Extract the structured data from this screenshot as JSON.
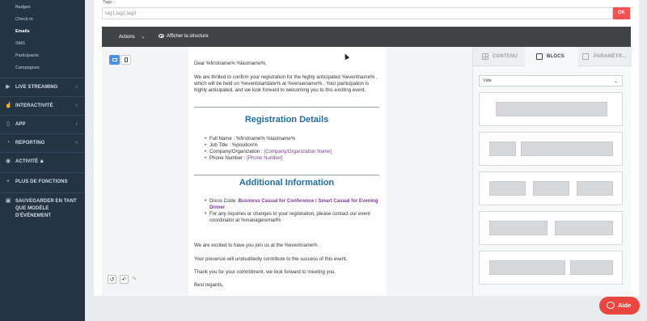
{
  "sidebar": {
    "sub_items": [
      {
        "label": "Badges"
      },
      {
        "label": "Check-in"
      },
      {
        "label": "Emails"
      },
      {
        "label": "SMS"
      },
      {
        "label": "Participants"
      },
      {
        "label": "Campagnes"
      }
    ],
    "sections": [
      {
        "label": "LIVE STREAMING",
        "icon": "play-icon"
      },
      {
        "label": "INTERACTIVITÉ",
        "icon": "interactivity-icon"
      },
      {
        "label": "APP",
        "icon": "phone-icon"
      },
      {
        "label": "REPORTING",
        "icon": "chart-icon"
      },
      {
        "label": "ACTIVITÉ",
        "icon": "eye-icon"
      },
      {
        "label": "PLUS DE FONCTIONS",
        "icon": "plus-icon"
      }
    ],
    "save_template": "SAUVEGARDER EN TANT QUE MODÈLE D'ÉVÉNEMENT"
  },
  "tags": {
    "label": "Tags :",
    "value": "tag1,tag2,tag3",
    "ok": "OK"
  },
  "toolbar": {
    "actions": "Actions",
    "show_structure": "Afficher la structure"
  },
  "email": {
    "greeting": "Dear %firstname% %lastname%,",
    "intro": "We are thrilled to confirm your registration for the highly anticipated %eventname% , which will be held on %eventstartdate% at %venuename% . Your participation is highly anticipated, and we look forward to welcoming you to this exciting event.",
    "reg_heading": "Registration Details",
    "reg_items": {
      "name": "Full Name : %firstname% %lastname%",
      "job": "Job Title : %position%",
      "company_label": "Company/Organization : ",
      "company_value": "[Company/Organization Name]",
      "phone_label": "Phone Number : ",
      "phone_value": "[Phone Number]"
    },
    "add_heading": "Additional Information",
    "add_items": {
      "dress_label": "Dress Code: ",
      "dress_value": "Business Casual for Conference / Smart Casual for Evening Dinner",
      "inquiries": "For any inquiries or changes to your registration, please contact our event coordinator at %manageremail%"
    },
    "excited": "We are excited to have you join us at the %eventname% .",
    "presence": "Your presence will undoubtedly contribute to the success of this event.",
    "thanks": "Thank you for your commitment. we look forward to meeting you.",
    "regards": "Best regards,"
  },
  "right_panel": {
    "tabs": [
      "CONTENU",
      "BLOCS",
      "PARAMÈTR..."
    ],
    "select_value": "Vide"
  },
  "help": {
    "label": "Aide"
  },
  "colors": {
    "sidebar": "#243442",
    "accent_red": "#ee5352",
    "heading_blue": "#1f6fa5",
    "purple": "#7d3c98",
    "toolbar": "#414446"
  }
}
